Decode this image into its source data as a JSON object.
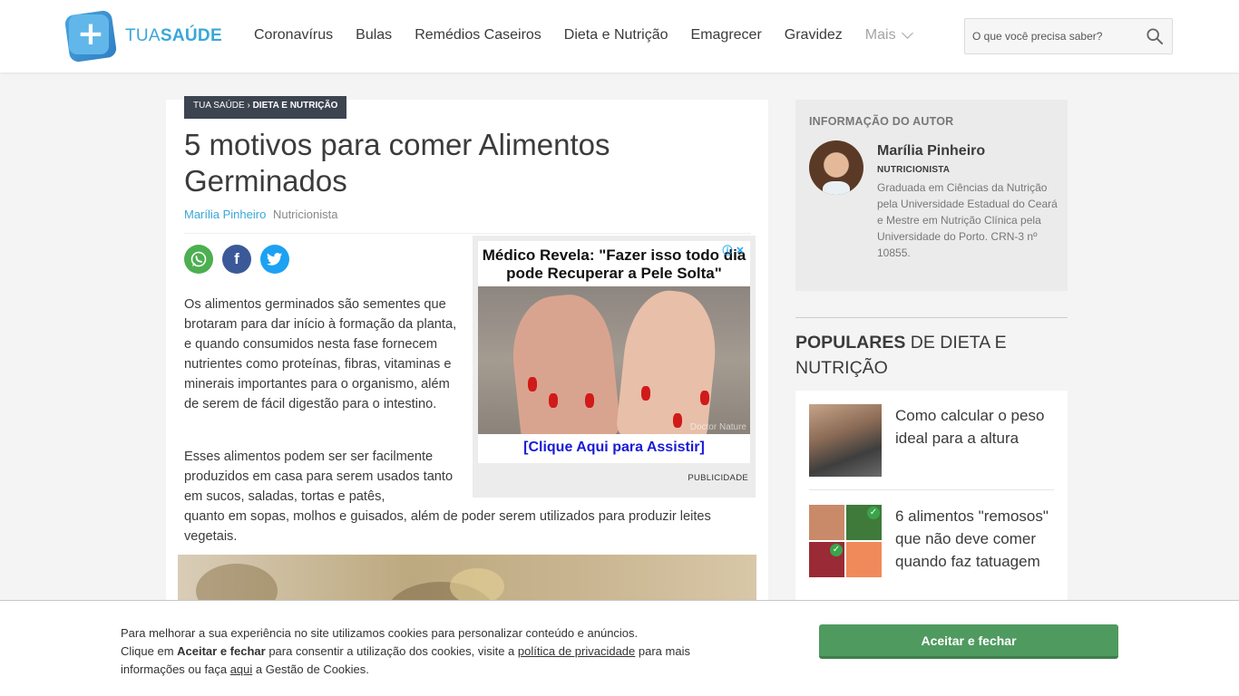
{
  "brand": {
    "logo_text_light": "TUA",
    "logo_text_bold": "SAÚDE"
  },
  "nav": {
    "items": [
      {
        "label": "Coronavírus"
      },
      {
        "label": "Bulas"
      },
      {
        "label": "Remédios Caseiros"
      },
      {
        "label": "Dieta e Nutrição"
      },
      {
        "label": "Emagrecer"
      },
      {
        "label": "Gravidez"
      }
    ],
    "more_label": "Mais"
  },
  "search": {
    "placeholder": "O que você precisa saber?"
  },
  "article": {
    "breadcrumb_home": "TUA SAÚDE",
    "breadcrumb_sep": " › ",
    "breadcrumb_section": "DIETA E NUTRIÇÃO",
    "title": "5 motivos para comer Alimentos Germinados",
    "author_name": "Marília Pinheiro",
    "author_role": "Nutricionista",
    "paragraph_1": "Os alimentos germinados são sementes que brotaram para dar início à formação da planta, e quando consumidos nesta fase fornecem nutrientes como proteínas, fibras, vitaminas e minerais importantes para o organismo, além de serem de fácil digestão para o intestino.",
    "paragraph_2a": "Esses alimentos podem ser ser facilmente produzidos em casa para serem usados tanto em sucos, saladas, tortas e patês,",
    "paragraph_2b": "quanto em sopas, molhos e guisados, além de poder serem utilizados para produzir leites vegetais."
  },
  "ad": {
    "headline": "Médico Revela: \"Fazer isso todo dia pode Recuperar a Pele Solta\"",
    "image_watermark": "Doctor Nature",
    "cta": "[Clique Aqui para Assistir]",
    "label": "PUBLICIDADE"
  },
  "author_box": {
    "title": "INFORMAÇÃO DO AUTOR",
    "name": "Marília Pinheiro",
    "role": "NUTRICIONISTA",
    "bio": "Graduada em Ciências da Nutrição pela Universidade Estadual do Ceará e Mestre em Nutrição Clínica pela Universidade do Porto. CRN-3 nº 10855."
  },
  "popular": {
    "title_bold": "POPULARES",
    "title_rest": " DE DIETA E NUTRIÇÃO",
    "items": [
      {
        "label": "Como calcular o peso ideal para a altura"
      },
      {
        "label": "6 alimentos \"remosos\" que não deve comer quando faz tatuagem"
      }
    ]
  },
  "cookie": {
    "line1": "Para melhorar a sua experiência no site utilizamos cookies para personalizar conteúdo e anúncios.",
    "line2_pre": "Clique em ",
    "line2_bold": "Aceitar e fechar",
    "line2_mid": " para consentir a utilização dos cookies, visite a ",
    "privacy_link": "política de privacidade",
    "line2_post": " para mais informações ou faça ",
    "here_link": "aqui",
    "line2_end": " a Gestão de Cookies.",
    "accept_button": "Aceitar e fechar"
  },
  "colors": {
    "brand_blue": "#3aa7d8",
    "dark_nav": "#3c4450",
    "accept_green": "#4f9a5f"
  }
}
